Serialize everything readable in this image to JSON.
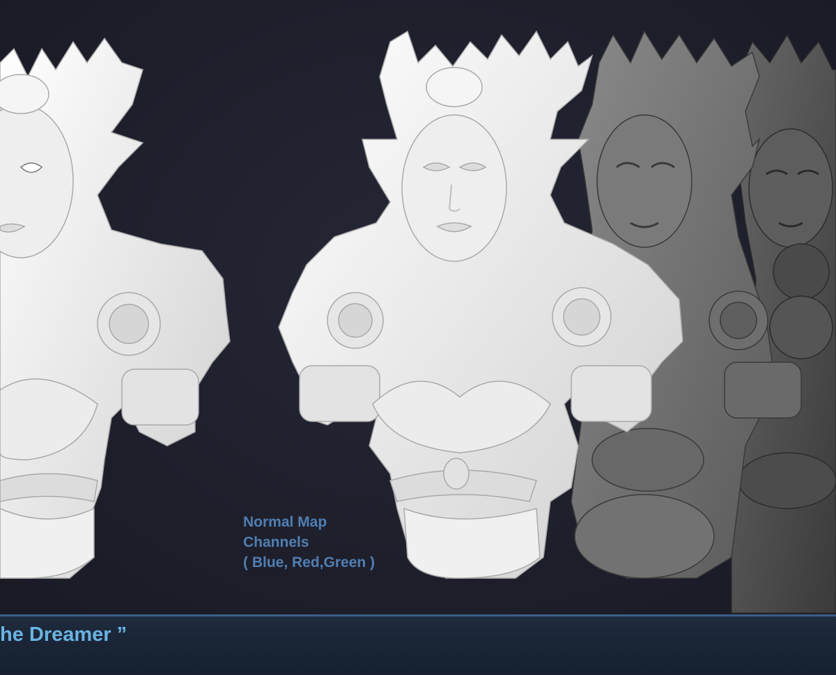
{
  "caption": {
    "line1": "Normal Map",
    "line2": "Channels",
    "line3": "( Blue, Red,Green )"
  },
  "banner": {
    "title": "he Dreamer ”"
  },
  "colors": {
    "background": "#1e1f2b",
    "caption_text": "#4f7fb3",
    "banner_bg": "#1a2536",
    "banner_text": "#6ab3e2",
    "banner_border": "#3c5f86"
  }
}
